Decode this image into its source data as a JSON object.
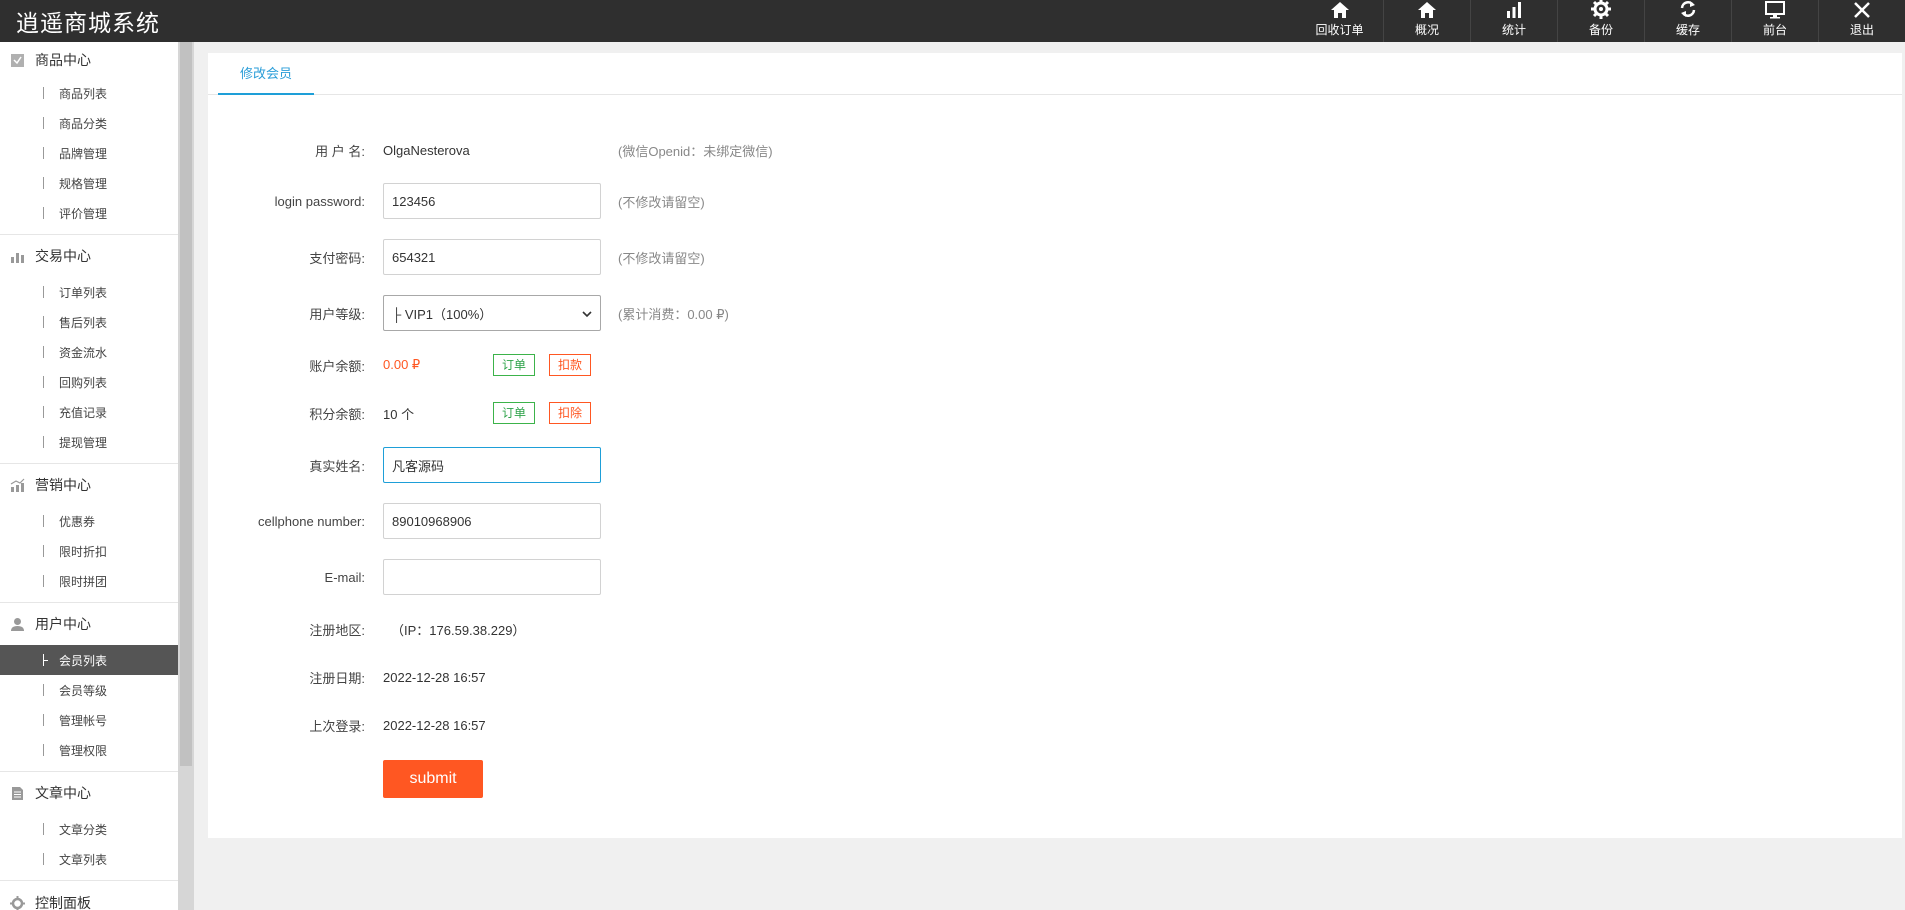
{
  "app": {
    "brand": "逍遥商城系统"
  },
  "topnav": [
    {
      "label": "回收订单",
      "icon": "home-icon"
    },
    {
      "label": "概况",
      "icon": "home-icon"
    },
    {
      "label": "统计",
      "icon": "bar-chart-icon"
    },
    {
      "label": "备份",
      "icon": "gear-icon"
    },
    {
      "label": "缓存",
      "icon": "refresh-icon"
    },
    {
      "label": "前台",
      "icon": "monitor-icon"
    },
    {
      "label": "退出",
      "icon": "close-icon"
    }
  ],
  "sidebar": {
    "groups": [
      {
        "title": "商品中心",
        "icon": "package-icon",
        "items": [
          "商品列表",
          "商品分类",
          "品牌管理",
          "规格管理",
          "评价管理"
        ]
      },
      {
        "title": "交易中心",
        "icon": "bar-chart-icon",
        "items": [
          "订单列表",
          "售后列表",
          "资金流水",
          "回购列表",
          "充值记录",
          "提现管理"
        ]
      },
      {
        "title": "营销中心",
        "icon": "trend-chart-icon",
        "items": [
          "优惠券",
          "限时折扣",
          "限时拼团"
        ]
      },
      {
        "title": "用户中心",
        "icon": "user-icon",
        "items": [
          "会员列表",
          "会员等级",
          "管理帐号",
          "管理权限"
        ],
        "active_index": 0
      },
      {
        "title": "文章中心",
        "icon": "document-icon",
        "items": [
          "文章分类",
          "文章列表"
        ]
      },
      {
        "title": "控制面板",
        "icon": "gear-icon",
        "items": []
      }
    ]
  },
  "tab": {
    "label": "修改会员"
  },
  "form": {
    "username": {
      "label": "用 户 名:",
      "value": "OlgaNesterova",
      "hint": "(微信Openid：未绑定微信)"
    },
    "login_password": {
      "label": "login password:",
      "value": "123456",
      "hint": "(不修改请留空)"
    },
    "pay_password": {
      "label": "支付密码:",
      "value": "654321",
      "hint": "(不修改请留空)"
    },
    "level": {
      "label": "用户等级:",
      "value": "├ VIP1（100%）",
      "hint": "(累计消费：0.00 ₽)"
    },
    "balance": {
      "label": "账户余额:",
      "value": "0.00 ₽",
      "btn_order": "订单",
      "btn_deduct": "扣款"
    },
    "points": {
      "label": "积分余额:",
      "value": "10 个",
      "btn_order": "订单",
      "btn_deduct": "扣除"
    },
    "real_name": {
      "label": "真实姓名:",
      "value": "凡客源码"
    },
    "phone": {
      "label": "cellphone number:",
      "value": "89010968906"
    },
    "email": {
      "label": "E-mail:",
      "value": ""
    },
    "region": {
      "label": "注册地区:",
      "value": "（IP：176.59.38.229）"
    },
    "reg_date": {
      "label": "注册日期:",
      "value": "2022-12-28 16:57"
    },
    "last_login": {
      "label": "上次登录:",
      "value": "2022-12-28 16:57"
    },
    "submit_label": "submit"
  },
  "colors": {
    "accent": "#ff5722",
    "tab": "#1e9fd8",
    "topbar": "#2f2f2f",
    "green": "#3cb34a"
  }
}
